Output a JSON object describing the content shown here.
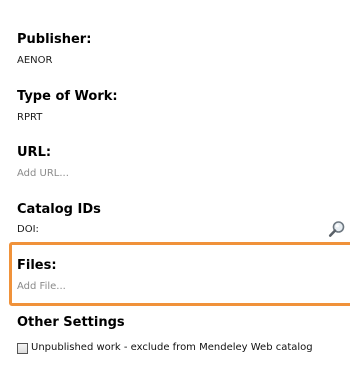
{
  "publisher": {
    "heading": "Publisher:",
    "value": "AENOR"
  },
  "type_of_work": {
    "heading": "Type of Work:",
    "value": "RPRT"
  },
  "url": {
    "heading": "URL:",
    "placeholder": "Add URL..."
  },
  "catalog_ids": {
    "heading": "Catalog IDs",
    "doi_label": "DOI:",
    "lookup_icon": "magnifier-icon"
  },
  "files": {
    "heading": "Files:",
    "placeholder": "Add File...",
    "highlight_color": "#f0923a"
  },
  "other_settings": {
    "heading": "Other Settings",
    "unpublished_label": "Unpublished work - exclude from Mendeley Web catalog",
    "unpublished_checked": false
  }
}
